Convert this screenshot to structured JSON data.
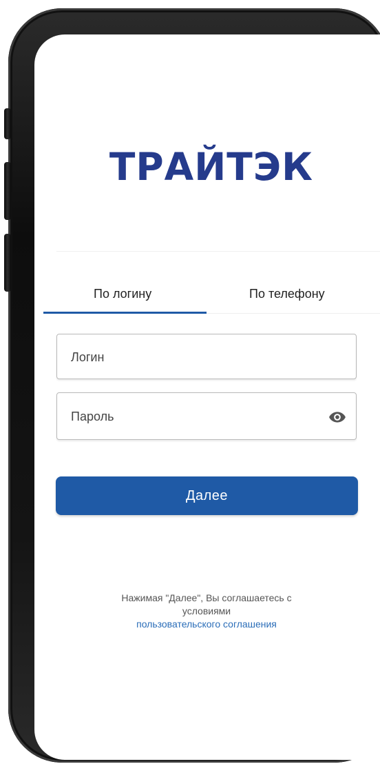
{
  "app": {
    "logo_text": "ТРАЙТЭК"
  },
  "tabs": [
    {
      "label": "По логину",
      "active": true
    },
    {
      "label": "По телефону",
      "active": false
    }
  ],
  "form": {
    "login_placeholder": "Логин",
    "login_value": "",
    "password_placeholder": "Пароль",
    "password_value": "",
    "show_password_icon": "eye-icon"
  },
  "actions": {
    "next_label": "Далее"
  },
  "terms": {
    "line1": "Нажимая \"Далее\", Вы соглашаетесь с",
    "line2": "условиями",
    "link_text": "пользовательского соглашения"
  },
  "colors": {
    "brand": "#253b8c",
    "accent": "#1f5aa6",
    "link": "#2a6db8"
  }
}
